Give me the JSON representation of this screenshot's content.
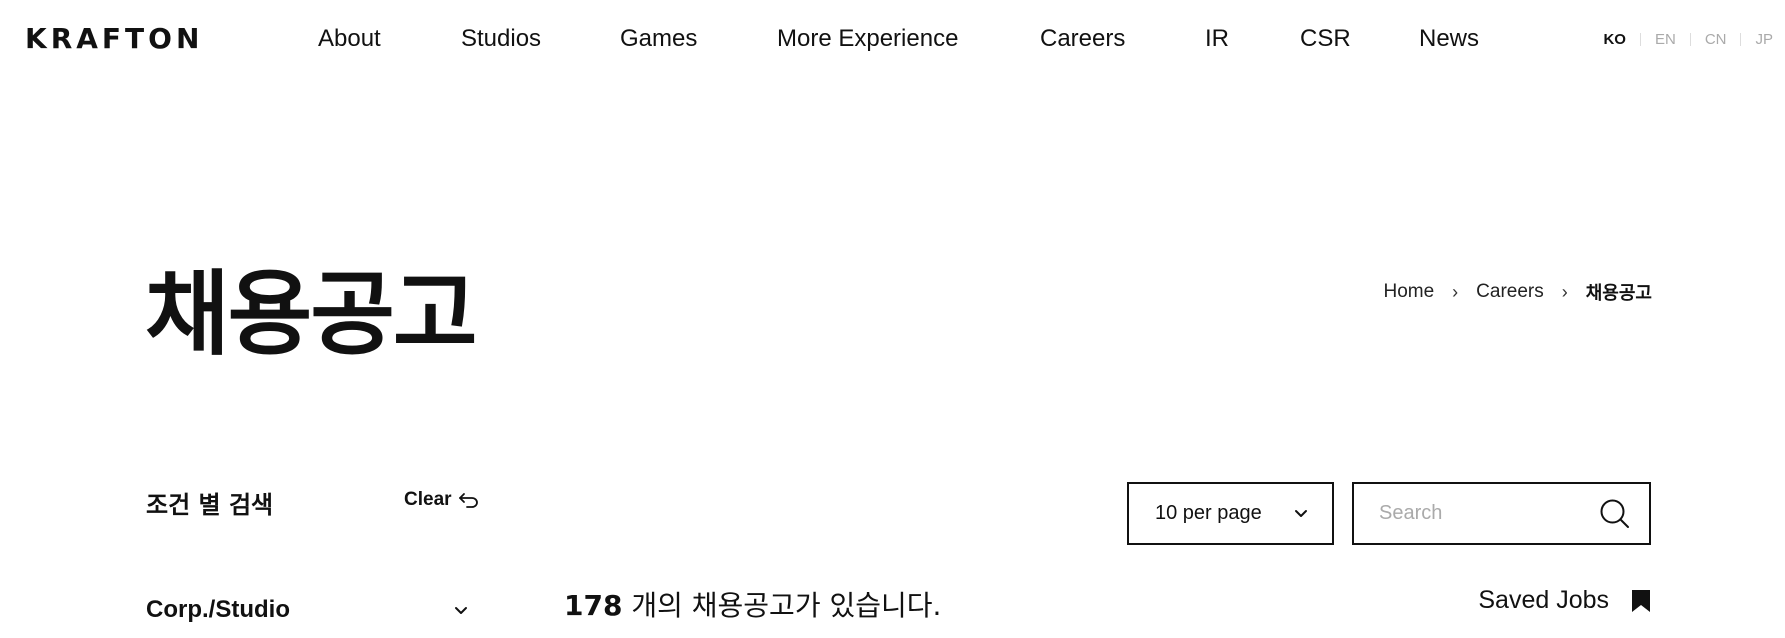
{
  "header": {
    "logo": "KRAFTON",
    "nav": [
      {
        "label": "About"
      },
      {
        "label": "Studios"
      },
      {
        "label": "Games"
      },
      {
        "label": "More Experience"
      },
      {
        "label": "Careers"
      },
      {
        "label": "IR"
      },
      {
        "label": "CSR"
      },
      {
        "label": "News"
      }
    ],
    "languages": [
      {
        "label": "KO",
        "active": true
      },
      {
        "label": "EN",
        "active": false
      },
      {
        "label": "CN",
        "active": false
      },
      {
        "label": "JP",
        "active": false
      }
    ]
  },
  "page": {
    "title": "채용공고",
    "breadcrumb": [
      "Home",
      "Careers",
      "채용공고"
    ]
  },
  "filters": {
    "title": "조건 별 검색",
    "clear_label": "Clear",
    "groups": [
      {
        "label": "Corp./Studio"
      }
    ]
  },
  "toolbar": {
    "per_page": "10 per page",
    "search_placeholder": "Search"
  },
  "results": {
    "count": "178",
    "count_suffix": "개의 채용공고가 있습니다.",
    "saved_jobs_label": "Saved Jobs"
  },
  "colors": {
    "text": "#111111",
    "muted": "#aaaaaa",
    "border": "#111111",
    "background": "#ffffff"
  }
}
